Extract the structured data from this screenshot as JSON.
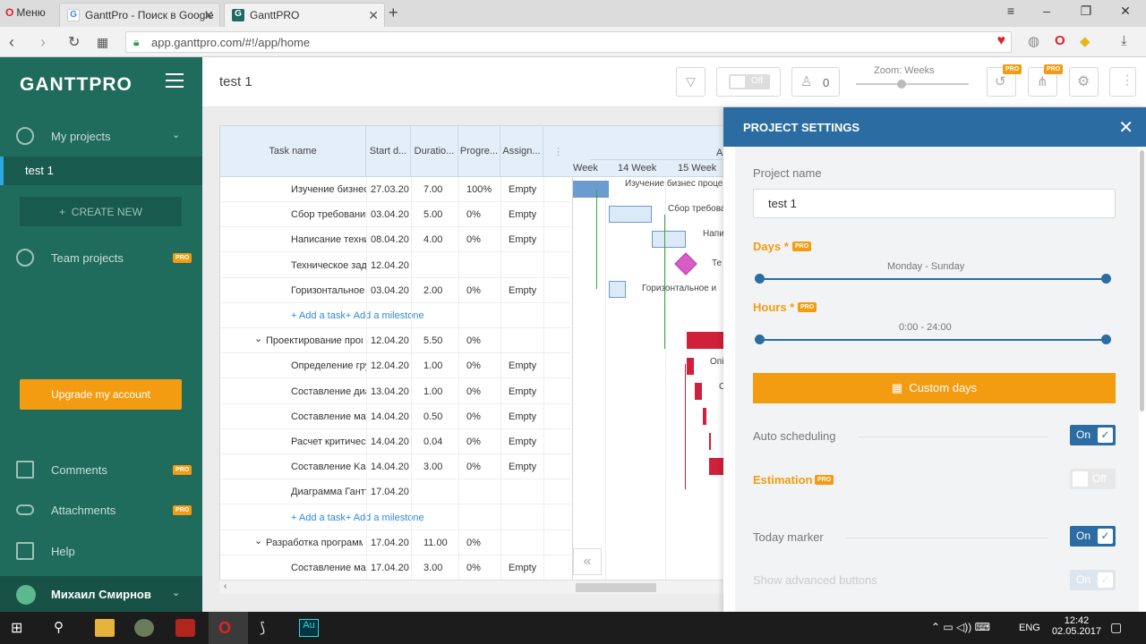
{
  "browser": {
    "menu_label": "Меню",
    "tabs": [
      {
        "title": "GanttPro - Поиск в Google"
      },
      {
        "title": "GanttPRO"
      }
    ],
    "url": "app.ganttpro.com/#!/app/home"
  },
  "sidebar": {
    "logo": "GANTTPRO",
    "my_projects": "My projects",
    "active_project": "test 1",
    "create_new": "CREATE NEW",
    "team_projects": "Team projects",
    "pro": "PRO",
    "upgrade": "Upgrade my account",
    "comments": "Comments",
    "attachments": "Attachments",
    "help": "Help",
    "user_name": "Михаил Смирнов"
  },
  "appbar": {
    "project_title": "test 1",
    "toggle_off": "Off",
    "people_count": "0",
    "zoom_label": "Zoom: Weeks"
  },
  "grid": {
    "columns": [
      "Task name",
      "Start d...",
      "Duratio...",
      "Progre...",
      "Assign..."
    ],
    "rows": [
      {
        "name": "Изучение бизнес п",
        "start": "27.03.20",
        "duration": "7.00",
        "progress": "100%",
        "assign": "Empty",
        "indent": 1
      },
      {
        "name": "Сбор требований",
        "start": "03.04.20",
        "duration": "5.00",
        "progress": "0%",
        "assign": "Empty",
        "indent": 1
      },
      {
        "name": "Написание технич",
        "start": "08.04.20",
        "duration": "4.00",
        "progress": "0%",
        "assign": "Empty",
        "indent": 1
      },
      {
        "name": "Техническое зада",
        "start": "12.04.20",
        "duration": "",
        "progress": "",
        "assign": "",
        "indent": 1
      },
      {
        "name": "Горизонтальное и",
        "start": "03.04.20",
        "duration": "2.00",
        "progress": "0%",
        "assign": "Empty",
        "indent": 1
      },
      {
        "name": "+ Add a task+ Add a milestone",
        "add": true
      },
      {
        "name": "Проектирование прогр",
        "start": "12.04.20",
        "duration": "5.50",
        "progress": "0%",
        "assign": "",
        "indent": 0,
        "group": true
      },
      {
        "name": "Определение гру",
        "start": "12.04.20",
        "duration": "1.00",
        "progress": "0%",
        "assign": "Empty",
        "indent": 1
      },
      {
        "name": "Составление диаг",
        "start": "13.04.20",
        "duration": "1.00",
        "progress": "0%",
        "assign": "Empty",
        "indent": 1
      },
      {
        "name": "Составление матр",
        "start": "14.04.20",
        "duration": "0.50",
        "progress": "0%",
        "assign": "Empty",
        "indent": 1
      },
      {
        "name": "Расчет критическ",
        "start": "14.04.20",
        "duration": "0.04",
        "progress": "0%",
        "assign": "Empty",
        "indent": 1
      },
      {
        "name": "Составление Kanl",
        "start": "14.04.20",
        "duration": "3.00",
        "progress": "0%",
        "assign": "Empty",
        "indent": 1
      },
      {
        "name": "Диаграмма Гантт",
        "start": "17.04.20",
        "duration": "",
        "progress": "",
        "assign": "",
        "indent": 1
      },
      {
        "name": "+ Add a task+ Add a milestone",
        "add": true
      },
      {
        "name": "Разработка программн",
        "start": "17.04.20",
        "duration": "11.00",
        "progress": "0%",
        "assign": "",
        "indent": 0,
        "group": true
      },
      {
        "name": "Составление маке",
        "start": "17.04.20",
        "duration": "3.00",
        "progress": "0%",
        "assign": "Empty",
        "indent": 1
      }
    ]
  },
  "chart": {
    "month": "Apr",
    "weeks": [
      "Week",
      "14 Week",
      "15 Week"
    ],
    "bar_labels": [
      "Изучение бизнес проце",
      "Сбор требова",
      "Напи",
      "Те",
      "Горизонтальное и",
      "Опі",
      "С"
    ]
  },
  "settings": {
    "title": "PROJECT SETTINGS",
    "project_name_label": "Project name",
    "project_name_value": "test 1",
    "days_label": "Days *",
    "days_value": "Monday - Sunday",
    "hours_label": "Hours *",
    "hours_value": "0:00 - 24:00",
    "custom_days": "Custom days",
    "auto_scheduling": "Auto scheduling",
    "estimation": "Estimation",
    "today_marker": "Today marker",
    "show_advanced": "Show advanced buttons",
    "on": "On",
    "off": "Off",
    "pro": "PRO"
  },
  "taskbar": {
    "lang": "ENG",
    "time": "12:42",
    "date": "02.05.2017"
  },
  "colors": {
    "sidebar": "#1f6b5c",
    "accent_orange": "#f39c12",
    "panel_blue": "#2b6ca3",
    "bar_red": "#d0203a"
  }
}
